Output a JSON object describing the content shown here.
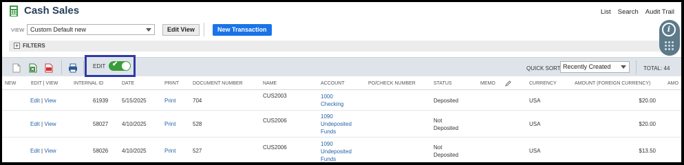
{
  "header": {
    "title": "Cash Sales",
    "links": [
      "List",
      "Search",
      "Audit Trail"
    ]
  },
  "view": {
    "label": "VIEW",
    "selected": "Custom Default new",
    "edit_view_label": "Edit View",
    "new_transaction_label": "New Transaction"
  },
  "filters": {
    "label": "FILTERS",
    "expand_symbol": "+"
  },
  "toolbar": {
    "edit_label": "EDIT",
    "edit_enabled": true,
    "quick_sort_label": "QUICK SORT",
    "quick_sort_value": "Recently Created",
    "total_label": "TOTAL: 44"
  },
  "table": {
    "columns": [
      "NEW",
      "EDIT | VIEW",
      "INTERNAL ID",
      "DATE",
      "PRINT",
      "DOCUMENT NUMBER",
      "NAME",
      "ACCOUNT",
      "PO/CHECK NUMBER",
      "STATUS",
      "MEMO",
      "CURRENCY",
      "AMOUNT (FOREIGN CURRENCY)",
      "AMO"
    ],
    "rows": [
      {
        "edit": "Edit",
        "sep": "|",
        "view": "View",
        "internal_id": "61939",
        "date": "5/15/2025",
        "print": "Print",
        "doc_number": "704",
        "name": "CUS2003",
        "account": [
          "1000",
          "Checking"
        ],
        "po_check": "",
        "status": [
          "Deposited"
        ],
        "memo": "",
        "currency": "USA",
        "amount_fc": "$20.00"
      },
      {
        "edit": "Edit",
        "sep": "|",
        "view": "View",
        "internal_id": "58027",
        "date": "4/10/2025",
        "print": "Print",
        "doc_number": "528",
        "name": "CUS2006",
        "account": [
          "1090",
          "Undeposited",
          "Funds"
        ],
        "po_check": "",
        "status": [
          "Not",
          "Deposited"
        ],
        "memo": "",
        "currency": "USA",
        "amount_fc": "$20.00"
      },
      {
        "edit": "Edit",
        "sep": "|",
        "view": "View",
        "internal_id": "58026",
        "date": "4/10/2025",
        "print": "Print",
        "doc_number": "527",
        "name": "CUS2006",
        "account": [
          "1090",
          "Undeposited",
          "Funds"
        ],
        "po_check": "",
        "status": [
          "Not",
          "Deposited"
        ],
        "memo": "",
        "currency": "USA",
        "amount_fc": "$13.50"
      }
    ]
  },
  "colors": {
    "title": "#253f5d",
    "primary_button": "#1a73e8",
    "link": "#2463a8",
    "toggle_on": "#3a9d3a",
    "highlight_border": "#2f3aa6",
    "toolbar_bg": "#dfe4eb"
  },
  "icons": {
    "page": "cash-sales-page-icon",
    "info": "info-icon",
    "more": "grip-dots-icon",
    "export_csv": "csv-export-icon",
    "export_excel": "excel-export-icon",
    "export_pdf": "pdf-export-icon",
    "print": "printer-icon",
    "memo_edit": "pencil-icon"
  }
}
